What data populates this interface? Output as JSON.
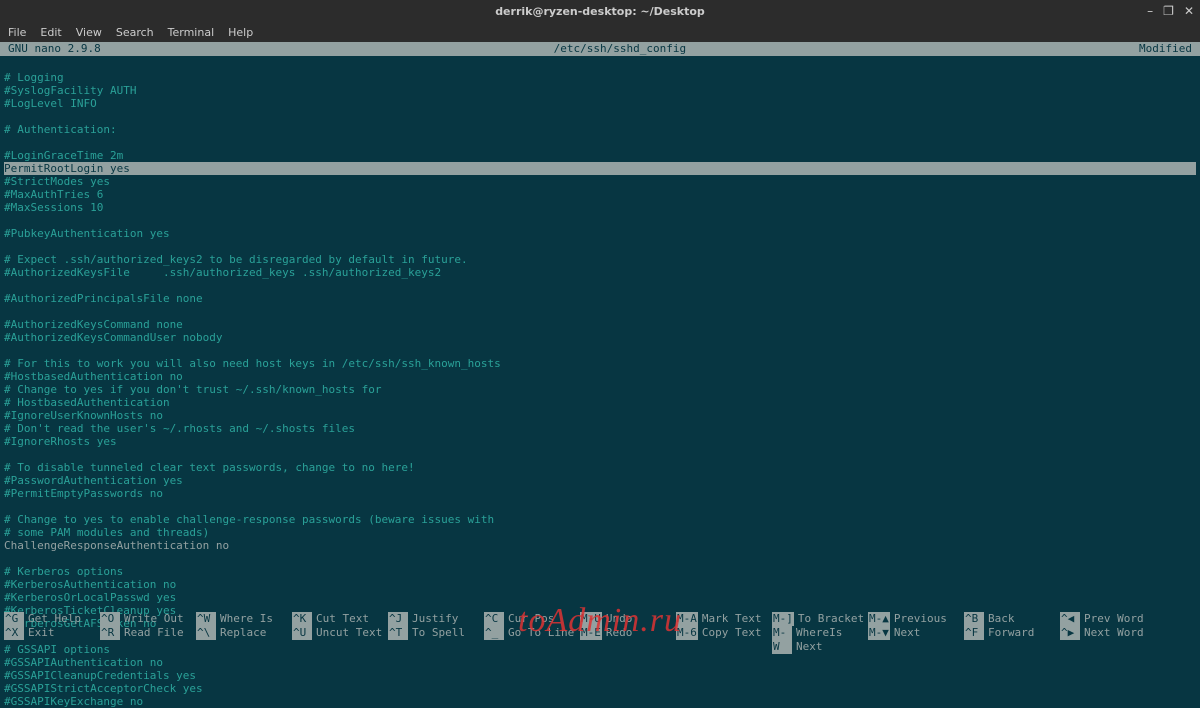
{
  "window": {
    "title": "derrik@ryzen-desktop: ~/Desktop",
    "controls": {
      "min": "–",
      "max": "❐",
      "close": "✕"
    }
  },
  "menubar": [
    "File",
    "Edit",
    "View",
    "Search",
    "Terminal",
    "Help"
  ],
  "nano": {
    "version": "GNU nano 2.9.8",
    "filepath": "/etc/ssh/sshd_config",
    "status": "Modified"
  },
  "editor_lines": [
    {
      "t": "",
      "style": ""
    },
    {
      "t": "# Logging",
      "style": ""
    },
    {
      "t": "#SyslogFacility AUTH",
      "style": ""
    },
    {
      "t": "#LogLevel INFO",
      "style": ""
    },
    {
      "t": "",
      "style": ""
    },
    {
      "t": "# Authentication:",
      "style": ""
    },
    {
      "t": "",
      "style": ""
    },
    {
      "t": "#LoginGraceTime 2m",
      "style": ""
    },
    {
      "t": "PermitRootLogin yes",
      "style": "hl"
    },
    {
      "t": "#StrictModes yes",
      "style": ""
    },
    {
      "t": "#MaxAuthTries 6",
      "style": ""
    },
    {
      "t": "#MaxSessions 10",
      "style": ""
    },
    {
      "t": "",
      "style": ""
    },
    {
      "t": "#PubkeyAuthentication yes",
      "style": ""
    },
    {
      "t": "",
      "style": ""
    },
    {
      "t": "# Expect .ssh/authorized_keys2 to be disregarded by default in future.",
      "style": ""
    },
    {
      "t": "#AuthorizedKeysFile     .ssh/authorized_keys .ssh/authorized_keys2",
      "style": ""
    },
    {
      "t": "",
      "style": ""
    },
    {
      "t": "#AuthorizedPrincipalsFile none",
      "style": ""
    },
    {
      "t": "",
      "style": ""
    },
    {
      "t": "#AuthorizedKeysCommand none",
      "style": ""
    },
    {
      "t": "#AuthorizedKeysCommandUser nobody",
      "style": ""
    },
    {
      "t": "",
      "style": ""
    },
    {
      "t": "# For this to work you will also need host keys in /etc/ssh/ssh_known_hosts",
      "style": ""
    },
    {
      "t": "#HostbasedAuthentication no",
      "style": ""
    },
    {
      "t": "# Change to yes if you don't trust ~/.ssh/known_hosts for",
      "style": ""
    },
    {
      "t": "# HostbasedAuthentication",
      "style": ""
    },
    {
      "t": "#IgnoreUserKnownHosts no",
      "style": ""
    },
    {
      "t": "# Don't read the user's ~/.rhosts and ~/.shosts files",
      "style": ""
    },
    {
      "t": "#IgnoreRhosts yes",
      "style": ""
    },
    {
      "t": "",
      "style": ""
    },
    {
      "t": "# To disable tunneled clear text passwords, change to no here!",
      "style": ""
    },
    {
      "t": "#PasswordAuthentication yes",
      "style": ""
    },
    {
      "t": "#PermitEmptyPasswords no",
      "style": ""
    },
    {
      "t": "",
      "style": ""
    },
    {
      "t": "# Change to yes to enable challenge-response passwords (beware issues with",
      "style": ""
    },
    {
      "t": "# some PAM modules and threads)",
      "style": ""
    },
    {
      "t": "ChallengeResponseAuthentication no",
      "style": "plain"
    },
    {
      "t": "",
      "style": ""
    },
    {
      "t": "# Kerberos options",
      "style": ""
    },
    {
      "t": "#KerberosAuthentication no",
      "style": ""
    },
    {
      "t": "#KerberosOrLocalPasswd yes",
      "style": ""
    },
    {
      "t": "#KerberosTicketCleanup yes",
      "style": ""
    },
    {
      "t": "#KerberosGetAFSToken no",
      "style": ""
    },
    {
      "t": "",
      "style": ""
    },
    {
      "t": "# GSSAPI options",
      "style": ""
    },
    {
      "t": "#GSSAPIAuthentication no",
      "style": ""
    },
    {
      "t": "#GSSAPICleanupCredentials yes",
      "style": ""
    },
    {
      "t": "#GSSAPIStrictAcceptorCheck yes",
      "style": ""
    },
    {
      "t": "#GSSAPIKeyExchange no",
      "style": ""
    }
  ],
  "footer": {
    "row1": [
      {
        "k": "^G",
        "l": "Get Help"
      },
      {
        "k": "^O",
        "l": "Write Out"
      },
      {
        "k": "^W",
        "l": "Where Is"
      },
      {
        "k": "^K",
        "l": "Cut Text"
      },
      {
        "k": "^J",
        "l": "Justify"
      },
      {
        "k": "^C",
        "l": "Cur Pos"
      },
      {
        "k": "M-U",
        "l": "Undo"
      },
      {
        "k": "M-A",
        "l": "Mark Text"
      },
      {
        "k": "M-]",
        "l": "To Bracket"
      },
      {
        "k": "M-▲",
        "l": "Previous"
      },
      {
        "k": "^B",
        "l": "Back"
      },
      {
        "k": "^◀",
        "l": "Prev Word"
      }
    ],
    "row2": [
      {
        "k": "^X",
        "l": "Exit"
      },
      {
        "k": "^R",
        "l": "Read File"
      },
      {
        "k": "^\\",
        "l": "Replace"
      },
      {
        "k": "^U",
        "l": "Uncut Text"
      },
      {
        "k": "^T",
        "l": "To Spell"
      },
      {
        "k": "^_",
        "l": "Go To Line"
      },
      {
        "k": "M-E",
        "l": "Redo"
      },
      {
        "k": "M-6",
        "l": "Copy Text"
      },
      {
        "k": "M-W",
        "l": "WhereIs Next"
      },
      {
        "k": "M-▼",
        "l": "Next"
      },
      {
        "k": "^F",
        "l": "Forward"
      },
      {
        "k": "^▶",
        "l": "Next Word"
      }
    ]
  },
  "watermark": "toAdmin.ru"
}
